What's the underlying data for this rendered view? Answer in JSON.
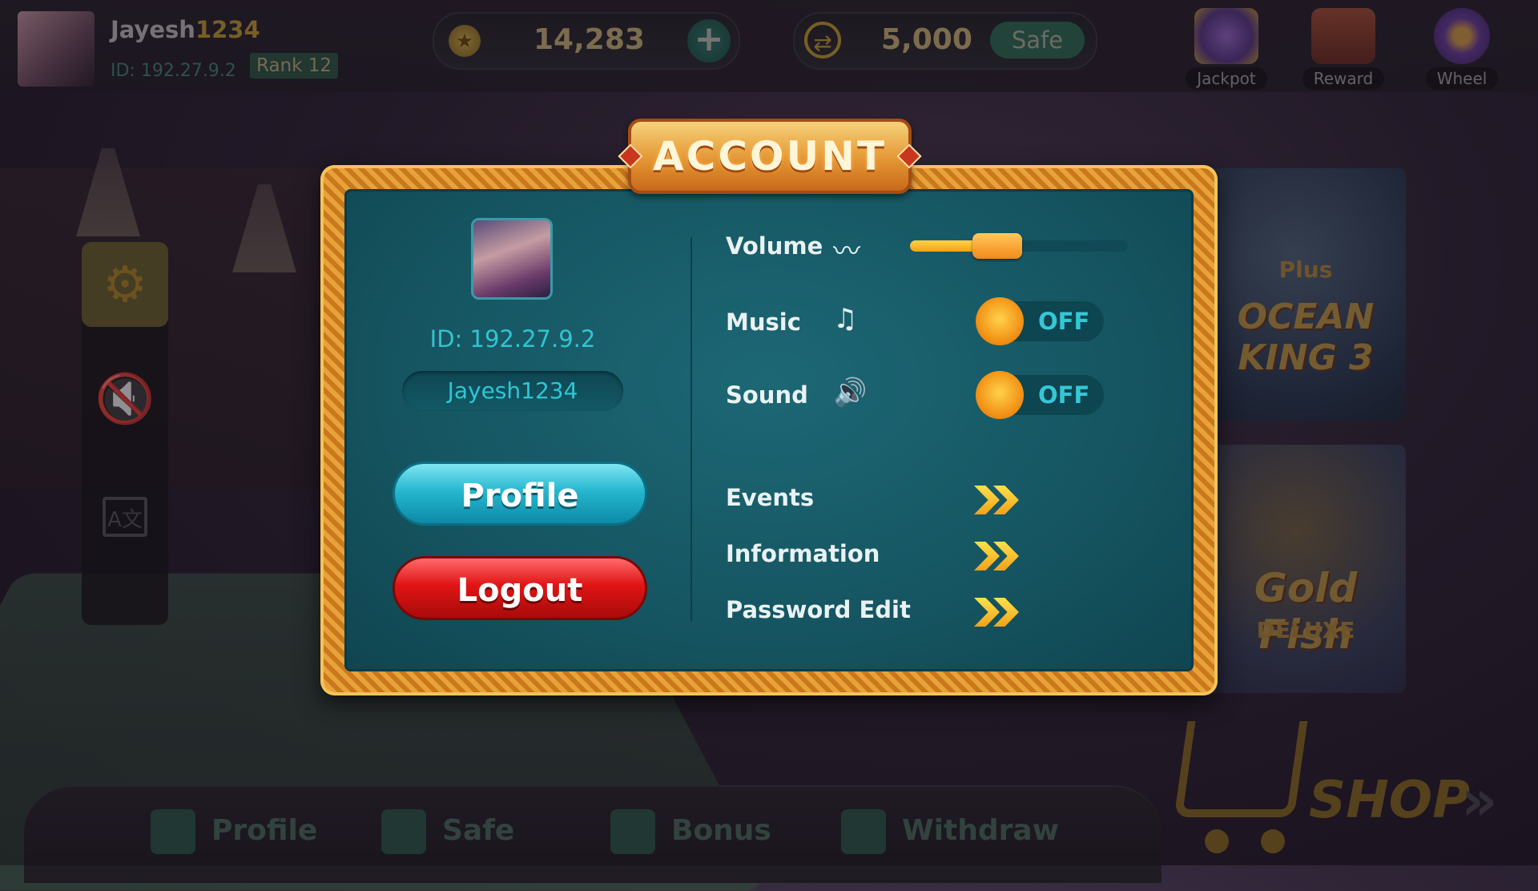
{
  "header": {
    "username_prefix": "Jayesh",
    "username_suffix": "1234",
    "user_id": "ID: 192.27.9.2",
    "rank": "Rank 12",
    "coins": "14,283",
    "safe_amount": "5,000",
    "safe_button": "Safe",
    "icons": [
      {
        "name": "jackpot-icon",
        "label": "Jackpot"
      },
      {
        "name": "reward-icon",
        "label": "Reward"
      },
      {
        "name": "wheel-icon",
        "label": "Wheel"
      }
    ]
  },
  "side_rail": {
    "icons": [
      "gear-icon",
      "mute-icon",
      "language-icon"
    ],
    "language_glyph": "A文"
  },
  "games": [
    {
      "title": "OCEAN KING 3",
      "subtitle": "Plus"
    },
    {
      "title": "Gold Fish",
      "subtitle": "DELUXE"
    }
  ],
  "account_modal": {
    "title": "ACCOUNT",
    "user_id": "ID: 192.27.9.2",
    "username": "Jayesh1234",
    "profile_button": "Profile",
    "logout_button": "Logout",
    "volume_label": "Volume",
    "volume_level": 0.4,
    "music_label": "Music",
    "music_state": "OFF",
    "sound_label": "Sound",
    "sound_state": "OFF",
    "links": [
      "Events",
      "Information",
      "Password Edit"
    ]
  },
  "bottom_nav": {
    "items": [
      "Profile",
      "Safe",
      "Bonus",
      "Withdraw"
    ],
    "shop_label": "SHOP"
  },
  "colors": {
    "accent_gold": "#e8a23a",
    "panel_teal": "#155561",
    "profile_button": "#26b7cf",
    "logout_button": "#e01414",
    "toggle_knob": "#f2a21a"
  }
}
